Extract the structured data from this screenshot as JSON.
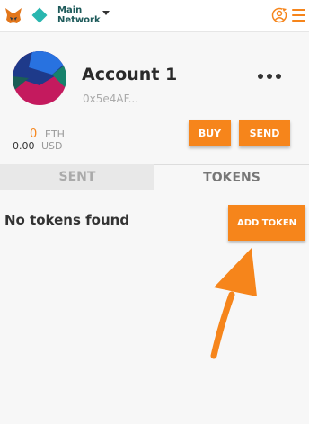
{
  "header": {
    "network_label_line1": "Main",
    "network_label_line2": "Network"
  },
  "account": {
    "name": "Account 1",
    "address": "0x5e4AF...",
    "eth_balance": "0",
    "eth_unit": "ETH",
    "usd_balance": "0.00",
    "usd_unit": "USD"
  },
  "actions": {
    "buy_label": "BUY",
    "send_label": "SEND"
  },
  "tabs": [
    {
      "label": "SENT"
    },
    {
      "label": "TOKENS"
    }
  ],
  "tokens": {
    "empty_message": "No tokens found",
    "add_token_label": "ADD TOKEN"
  },
  "colors": {
    "accent": "#f6851b",
    "network": "#29b6af"
  },
  "icons": [
    "metamask-fox-icon",
    "network-diamond-icon",
    "chevron-down-icon",
    "account-sync-icon",
    "menu-icon",
    "more-options-icon",
    "annotation-arrow"
  ]
}
